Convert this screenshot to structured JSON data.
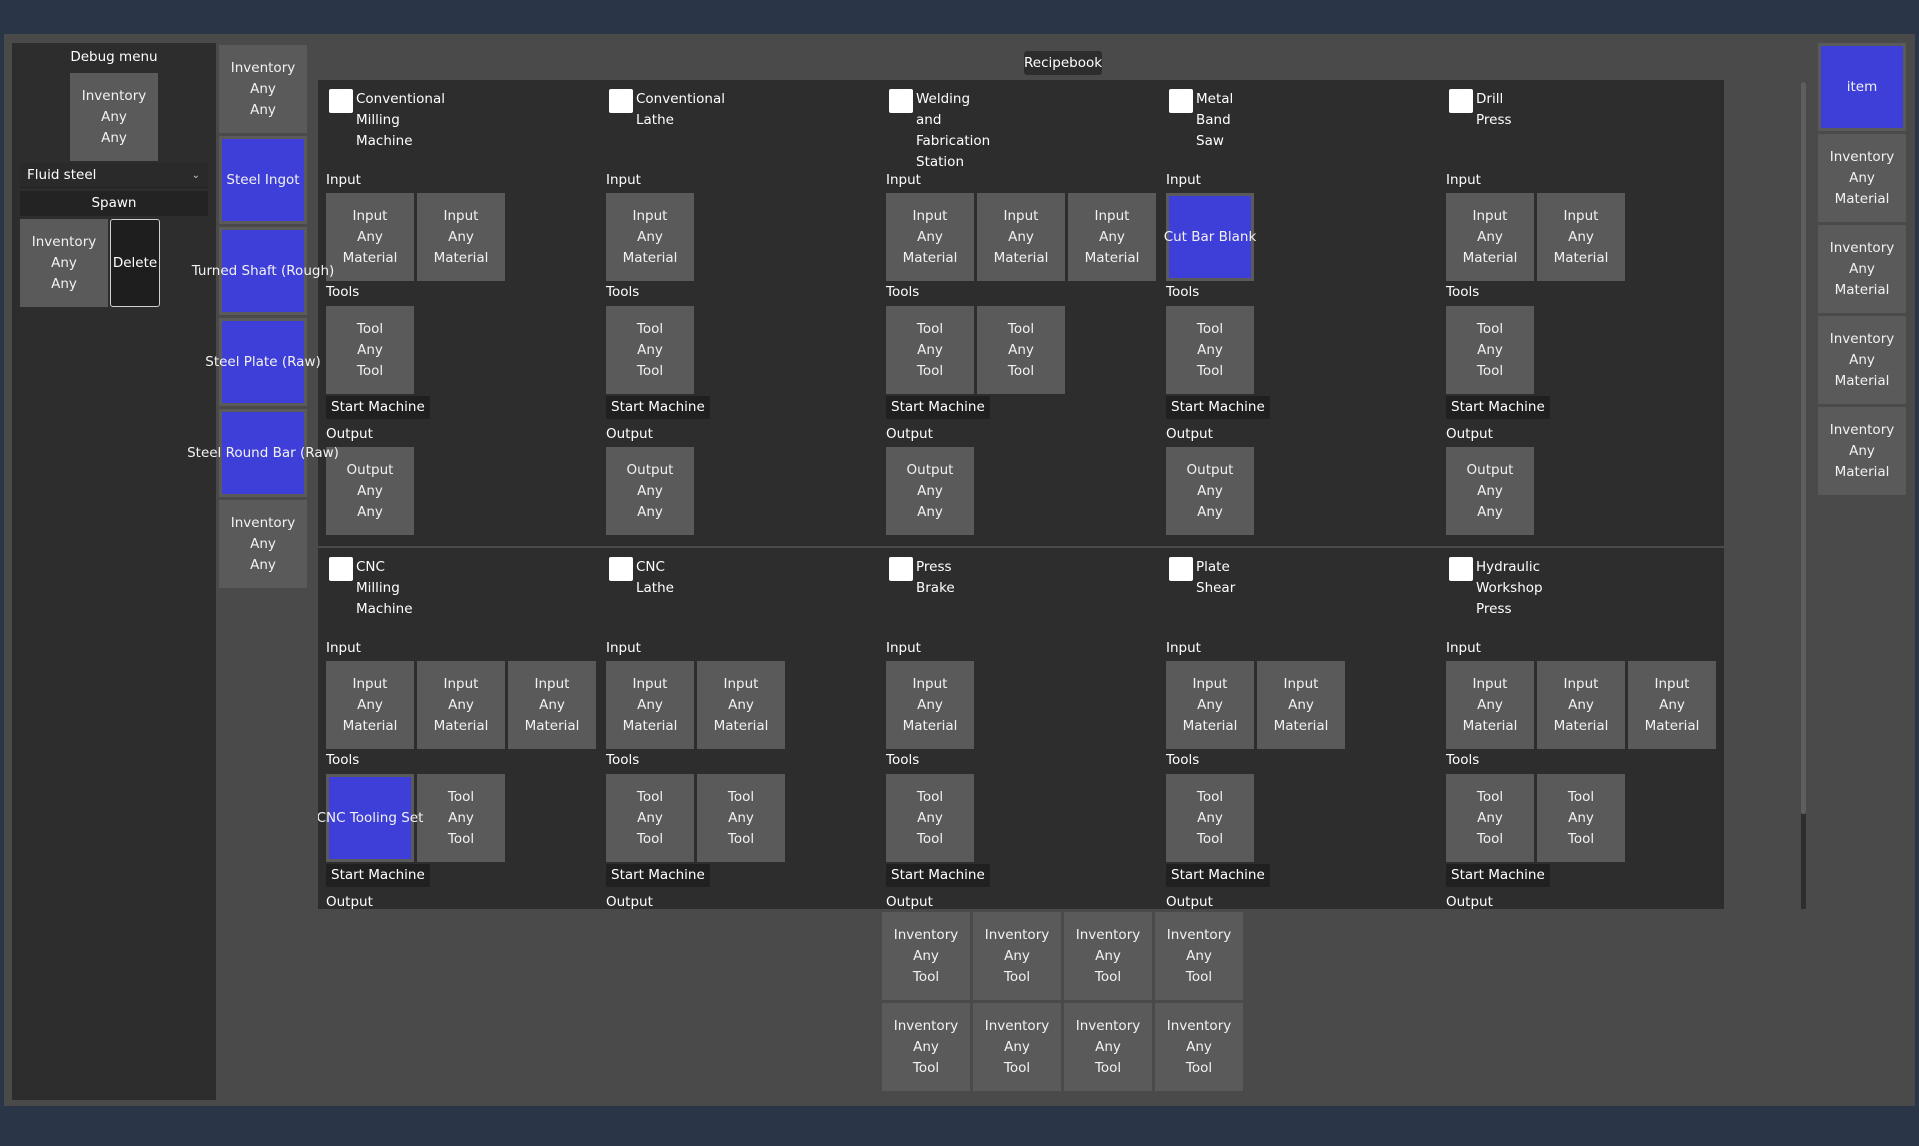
{
  "debug_menu": {
    "title": "Debug menu",
    "top_slot": "Inventory\nAny\nAny",
    "fluid_select": "Fluid steel",
    "spawn_label": "Spawn",
    "spawn_slot": "Inventory\nAny\nAny",
    "delete_label": "Delete"
  },
  "left_inventory": [
    {
      "label": "Inventory\nAny\nAny",
      "item": false
    },
    {
      "label": "Steel Ingot",
      "item": true
    },
    {
      "label": "Turned Shaft (Rough)",
      "item": true
    },
    {
      "label": "Steel Plate (Raw)",
      "item": true
    },
    {
      "label": "Steel Round Bar (Raw)",
      "item": true
    },
    {
      "label": "Inventory\nAny\nAny",
      "item": false
    }
  ],
  "recipebook": {
    "button_label": "Recipebook",
    "section_labels": {
      "input": "Input",
      "tools": "Tools",
      "start": "Start Machine",
      "output": "Output"
    },
    "machines": [
      {
        "name": "Conventional\nMilling\nMachine",
        "inputs": [
          {
            "label": "Input\nAny\nMaterial",
            "item": false
          },
          {
            "label": "Input\nAny\nMaterial",
            "item": false
          }
        ],
        "tools": [
          {
            "label": "Tool\nAny\nTool",
            "item": false
          }
        ],
        "outputs": [
          {
            "label": "Output\nAny\nAny",
            "item": false
          }
        ]
      },
      {
        "name": "Conventional\nLathe",
        "inputs": [
          {
            "label": "Input\nAny\nMaterial",
            "item": false
          }
        ],
        "tools": [
          {
            "label": "Tool\nAny\nTool",
            "item": false
          }
        ],
        "outputs": [
          {
            "label": "Output\nAny\nAny",
            "item": false
          }
        ]
      },
      {
        "name": "Welding\nand\nFabrication\nStation",
        "inputs": [
          {
            "label": "Input\nAny\nMaterial",
            "item": false
          },
          {
            "label": "Input\nAny\nMaterial",
            "item": false
          },
          {
            "label": "Input\nAny\nMaterial",
            "item": false
          }
        ],
        "tools": [
          {
            "label": "Tool\nAny\nTool",
            "item": false
          },
          {
            "label": "Tool\nAny\nTool",
            "item": false
          }
        ],
        "outputs": [
          {
            "label": "Output\nAny\nAny",
            "item": false
          }
        ]
      },
      {
        "name": "Metal\nBand\nSaw",
        "inputs": [
          {
            "label": "Cut Bar Blank",
            "item": true
          }
        ],
        "tools": [
          {
            "label": "Tool\nAny\nTool",
            "item": false
          }
        ],
        "outputs": [
          {
            "label": "Output\nAny\nAny",
            "item": false
          }
        ]
      },
      {
        "name": "Drill\nPress",
        "inputs": [
          {
            "label": "Input\nAny\nMaterial",
            "item": false
          },
          {
            "label": "Input\nAny\nMaterial",
            "item": false
          }
        ],
        "tools": [
          {
            "label": "Tool\nAny\nTool",
            "item": false
          }
        ],
        "outputs": [
          {
            "label": "Output\nAny\nAny",
            "item": false
          }
        ]
      },
      {
        "name": "CNC\nMilling\nMachine",
        "inputs": [
          {
            "label": "Input\nAny\nMaterial",
            "item": false
          },
          {
            "label": "Input\nAny\nMaterial",
            "item": false
          },
          {
            "label": "Input\nAny\nMaterial",
            "item": false
          }
        ],
        "tools": [
          {
            "label": "CNC Tooling Set",
            "item": true
          },
          {
            "label": "Tool\nAny\nTool",
            "item": false
          }
        ],
        "outputs": []
      },
      {
        "name": "CNC\nLathe",
        "inputs": [
          {
            "label": "Input\nAny\nMaterial",
            "item": false
          },
          {
            "label": "Input\nAny\nMaterial",
            "item": false
          }
        ],
        "tools": [
          {
            "label": "Tool\nAny\nTool",
            "item": false
          },
          {
            "label": "Tool\nAny\nTool",
            "item": false
          }
        ],
        "outputs": []
      },
      {
        "name": "Press\nBrake",
        "inputs": [
          {
            "label": "Input\nAny\nMaterial",
            "item": false
          }
        ],
        "tools": [
          {
            "label": "Tool\nAny\nTool",
            "item": false
          }
        ],
        "outputs": []
      },
      {
        "name": "Plate\nShear",
        "inputs": [
          {
            "label": "Input\nAny\nMaterial",
            "item": false
          },
          {
            "label": "Input\nAny\nMaterial",
            "item": false
          }
        ],
        "tools": [
          {
            "label": "Tool\nAny\nTool",
            "item": false
          }
        ],
        "outputs": []
      },
      {
        "name": "Hydraulic\nWorkshop\nPress",
        "inputs": [
          {
            "label": "Input\nAny\nMaterial",
            "item": false
          },
          {
            "label": "Input\nAny\nMaterial",
            "item": false
          },
          {
            "label": "Input\nAny\nMaterial",
            "item": false
          }
        ],
        "tools": [
          {
            "label": "Tool\nAny\nTool",
            "item": false
          },
          {
            "label": "Tool\nAny\nTool",
            "item": false
          }
        ],
        "outputs": []
      }
    ]
  },
  "tool_inventory": [
    "Inventory\nAny\nTool",
    "Inventory\nAny\nTool",
    "Inventory\nAny\nTool",
    "Inventory\nAny\nTool",
    "Inventory\nAny\nTool",
    "Inventory\nAny\nTool",
    "Inventory\nAny\nTool",
    "Inventory\nAny\nTool"
  ],
  "right_inventory": [
    {
      "label": "item",
      "item": true
    },
    {
      "label": "Inventory\nAny\nMaterial",
      "item": false
    },
    {
      "label": "Inventory\nAny\nMaterial",
      "item": false
    },
    {
      "label": "Inventory\nAny\nMaterial",
      "item": false
    },
    {
      "label": "Inventory\nAny\nMaterial",
      "item": false
    }
  ],
  "colors": {
    "item_blue": "#3e3ed8",
    "slot_gray": "#5a5a5a",
    "panel_dark": "#2d2d2d",
    "frame_gray": "#4a4a4a",
    "title_bar": "#2a3547"
  }
}
